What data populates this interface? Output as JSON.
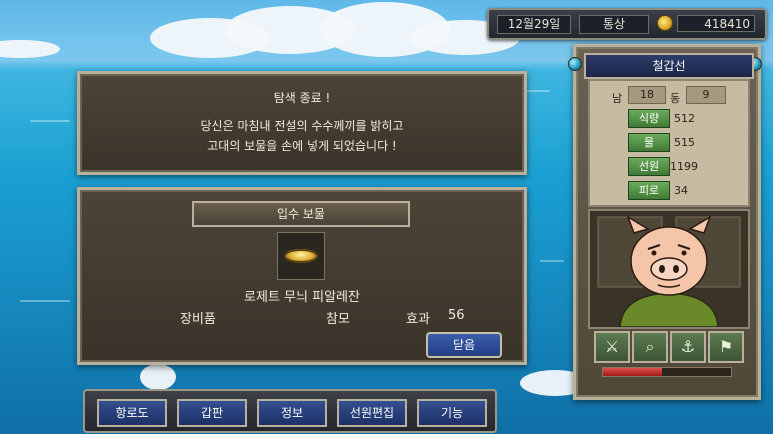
{
  "status": {
    "date": "12월29일",
    "mode": "통상",
    "gold": "418410",
    "icons": {
      "gold": "gold-coin-icon"
    }
  },
  "message": {
    "title": "탐색 종료 !",
    "line1": "당신은 마침내 전설의 수수께끼를 밝히고",
    "line2": "고대의 보물을 손에 넣게 되었습니다 !"
  },
  "treasure": {
    "header": "입수 보물",
    "name": "로제트 무늬 피알레잔",
    "category": "장비품",
    "type": "참모",
    "effect_label": "효과",
    "effect_value": "56",
    "close_label": "닫음",
    "icon": "gold-dish-icon"
  },
  "ship": {
    "name": "철갑선",
    "south_label": "남",
    "south_value": "18",
    "east_label": "동",
    "east_value": "9",
    "stats": [
      {
        "label": "식량",
        "value": "512"
      },
      {
        "label": "물",
        "value": "515"
      },
      {
        "label": "선원",
        "value": "1199"
      },
      {
        "label": "피로",
        "value": "34"
      }
    ],
    "actions": [
      "swords-icon",
      "magnifier-icon",
      "anchor-icon",
      "flag-icon"
    ],
    "durability_fraction": 0.46
  },
  "menu": {
    "items": [
      "항로도",
      "갑판",
      "정보",
      "선원편집",
      "기능"
    ]
  }
}
